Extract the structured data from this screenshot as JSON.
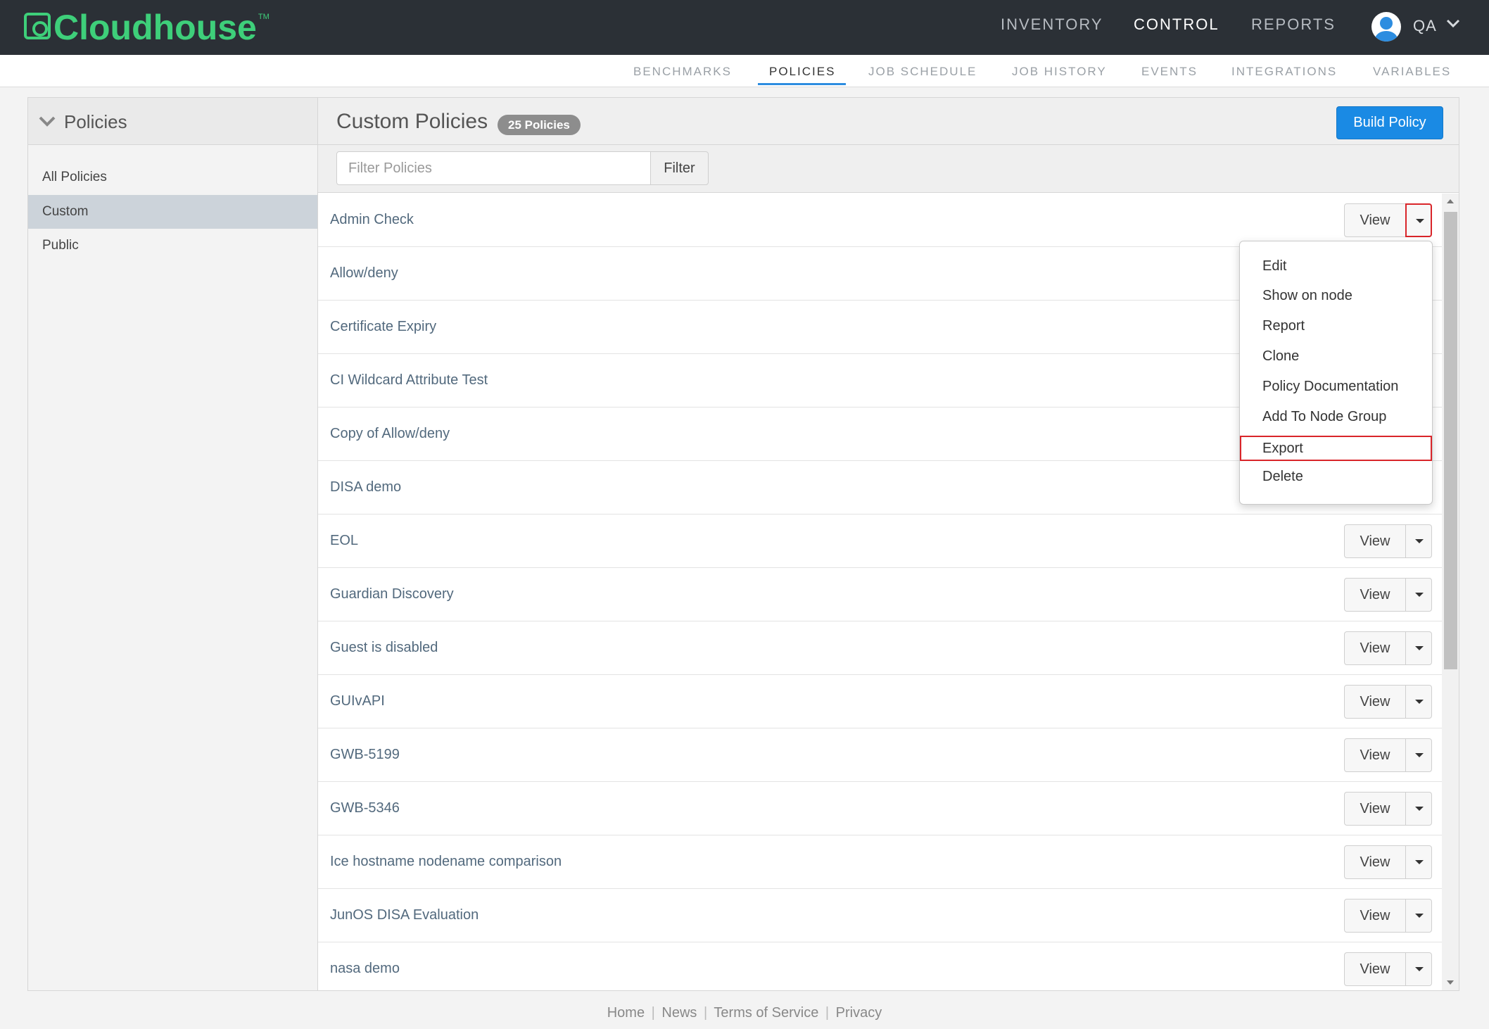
{
  "brand": {
    "name": "Cloudhouse",
    "tm": "TM",
    "color": "#3ecf7a"
  },
  "main_nav": [
    {
      "label": "INVENTORY",
      "active": false
    },
    {
      "label": "CONTROL",
      "active": true
    },
    {
      "label": "REPORTS",
      "active": false
    }
  ],
  "user": {
    "label": "QA"
  },
  "sub_nav": [
    {
      "label": "BENCHMARKS",
      "active": false
    },
    {
      "label": "POLICIES",
      "active": true
    },
    {
      "label": "JOB SCHEDULE",
      "active": false
    },
    {
      "label": "JOB HISTORY",
      "active": false
    },
    {
      "label": "EVENTS",
      "active": false
    },
    {
      "label": "INTEGRATIONS",
      "active": false
    },
    {
      "label": "VARIABLES",
      "active": false
    }
  ],
  "sidebar": {
    "title": "Policies",
    "items": [
      {
        "label": "All Policies",
        "selected": false
      },
      {
        "label": "Custom",
        "selected": true
      },
      {
        "label": "Public",
        "selected": false
      }
    ]
  },
  "main": {
    "title": "Custom Policies",
    "count_badge": "25 Policies",
    "build_button": "Build Policy",
    "filter_placeholder": "Filter Policies",
    "filter_button": "Filter",
    "view_label": "View",
    "policies": [
      "Admin Check",
      "Allow/deny",
      "Certificate Expiry",
      "CI Wildcard Attribute Test",
      "Copy of Allow/deny",
      "DISA demo",
      "EOL",
      "Guardian Discovery",
      "Guest is disabled",
      "GUIvAPI",
      "GWB-5199",
      "GWB-5346",
      "Ice hostname nodename comparison",
      "JunOS DISA Evaluation",
      "nasa demo"
    ]
  },
  "dropdown_menu": {
    "items": [
      "Edit",
      "Show on node",
      "Report",
      "Clone",
      "Policy Documentation",
      "Add To Node Group",
      "Export",
      "Delete"
    ],
    "highlighted": "Export"
  },
  "footer": {
    "links": [
      "Home",
      "News",
      "Terms of Service",
      "Privacy"
    ],
    "separator": "|"
  },
  "colors": {
    "topbar": "#2b3036",
    "accent": "#1a8ae4",
    "highlight_border": "#d9252a"
  }
}
